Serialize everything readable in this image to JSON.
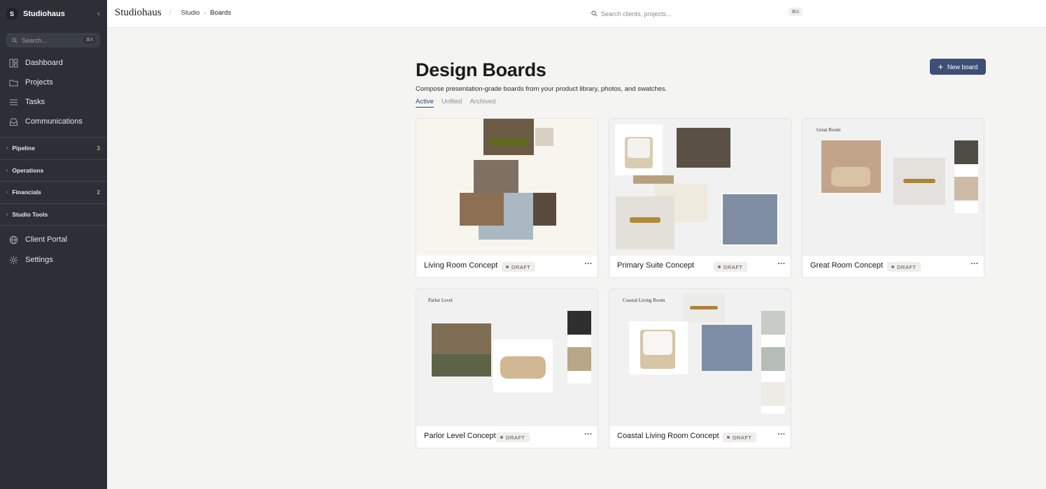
{
  "workspace": {
    "initial": "S",
    "name": "Studiohaus",
    "collapse_icon": "chevron-left-icon"
  },
  "sidebar": {
    "search_placeholder": "Search...",
    "search_shortcut": "⌘K",
    "nav": [
      {
        "label": "Dashboard",
        "icon": "dashboard-icon"
      },
      {
        "label": "Projects",
        "icon": "folder-icon"
      },
      {
        "label": "Tasks",
        "icon": "list-icon"
      },
      {
        "label": "Communications",
        "icon": "inbox-icon"
      }
    ],
    "sections": [
      {
        "label": "Pipeline",
        "count": "3"
      },
      {
        "label": "Operations",
        "count": ""
      },
      {
        "label": "Financials",
        "count": "2"
      },
      {
        "label": "Studio Tools",
        "count": ""
      }
    ],
    "bottom_nav": [
      {
        "label": "Client Portal",
        "icon": "globe-icon"
      },
      {
        "label": "Settings",
        "icon": "settings-icon"
      }
    ]
  },
  "header": {
    "brand": "Studiohaus",
    "breadcrumb": [
      "Studio",
      "Boards"
    ],
    "search_placeholder": "Search clients, projects...",
    "search_shortcut": "⌘K"
  },
  "page": {
    "title": "Design Boards",
    "subtitle": "Compose presentation-grade boards from your product library, photos, and swatches.",
    "new_button": "New board",
    "tabs": [
      "Active",
      "Unfiled",
      "Archived"
    ],
    "active_tab": "Active"
  },
  "boards": [
    {
      "name": "Living Room Concept",
      "status": "DRAFT",
      "board_title": ""
    },
    {
      "name": "Primary Suite Concept",
      "status": "DRAFT",
      "board_title": ""
    },
    {
      "name": "Great Room Concept",
      "status": "DRAFT",
      "board_title": "Great Room"
    },
    {
      "name": "Parlor Level Concept",
      "status": "DRAFT",
      "board_title": "Parlor Level"
    },
    {
      "name": "Coastal Living Room Concept",
      "status": "DRAFT",
      "board_title": "Coastal Living Room"
    }
  ],
  "colors": {
    "sidebar": "#2c2f35",
    "accent": "#3d4f78",
    "count": "#e59a7a",
    "canvas": "#f1f1f1"
  }
}
